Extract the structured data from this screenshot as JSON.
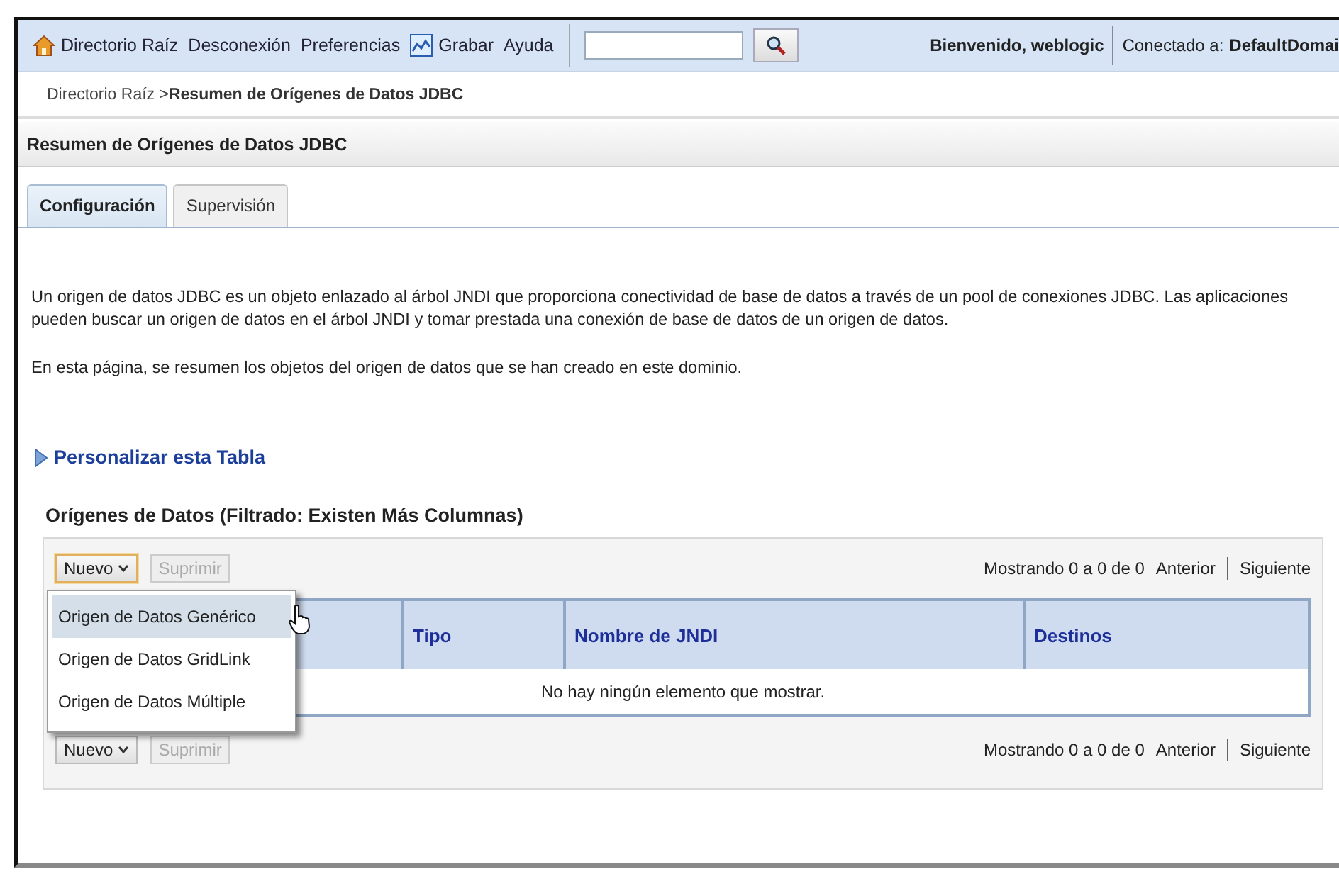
{
  "top_bar": {
    "links": [
      "Directorio Raíz",
      "Desconexión",
      "Preferencias",
      "Grabar",
      "Ayuda"
    ],
    "welcome": "Bienvenido, weblogic",
    "connected_label": "Conectado a:",
    "domain": "DefaultDomai"
  },
  "breadcrumb": {
    "parent": "Directorio Raíz >",
    "current": "Resumen de Orígenes de Datos JDBC"
  },
  "page_title": "Resumen de Orígenes de Datos JDBC",
  "tabs": [
    {
      "label": "Configuración",
      "selected": true
    },
    {
      "label": "Supervisión",
      "selected": false
    }
  ],
  "paragraphs": [
    "Un origen de datos JDBC es un objeto enlazado al árbol JNDI que proporciona conectividad de base de datos a través de un pool de conexiones JDBC. Las aplicaciones pueden buscar un origen de datos en el árbol JNDI y tomar prestada una conexión de base de datos de un origen de datos.",
    "En esta página, se resumen los objetos del origen de datos que se han creado en este dominio."
  ],
  "customize_link": "Personalizar esta Tabla",
  "table": {
    "title": "Orígenes de Datos (Filtrado: Existen Más Columnas)",
    "toolbars": [
      {
        "buttons": [
          {
            "label": "Nuevo",
            "dropdown": true,
            "disabled": false,
            "focused": true
          },
          {
            "label": "Suprimir",
            "dropdown": false,
            "disabled": true,
            "focused": false
          }
        ],
        "paging": "Mostrando 0 a 0 de 0",
        "prev": "Anterior",
        "next": "Siguiente"
      },
      {
        "buttons": [
          {
            "label": "Nuevo",
            "dropdown": true,
            "disabled": false,
            "focused": false
          },
          {
            "label": "Suprimir",
            "dropdown": false,
            "disabled": true,
            "focused": false
          }
        ],
        "paging": "Mostrando 0 a 0 de 0",
        "prev": "Anterior",
        "next": "Siguiente"
      }
    ],
    "columns": [
      "",
      "Tipo",
      "Nombre de JNDI",
      "Destinos"
    ],
    "empty_message": "No hay ningún elemento que mostrar."
  },
  "dropdown_menu": {
    "items": [
      {
        "label": "Origen de Datos Genérico",
        "selected": true
      },
      {
        "label": "Origen de Datos GridLink",
        "selected": false
      },
      {
        "label": "Origen de Datos Múltiple",
        "selected": false
      }
    ]
  }
}
